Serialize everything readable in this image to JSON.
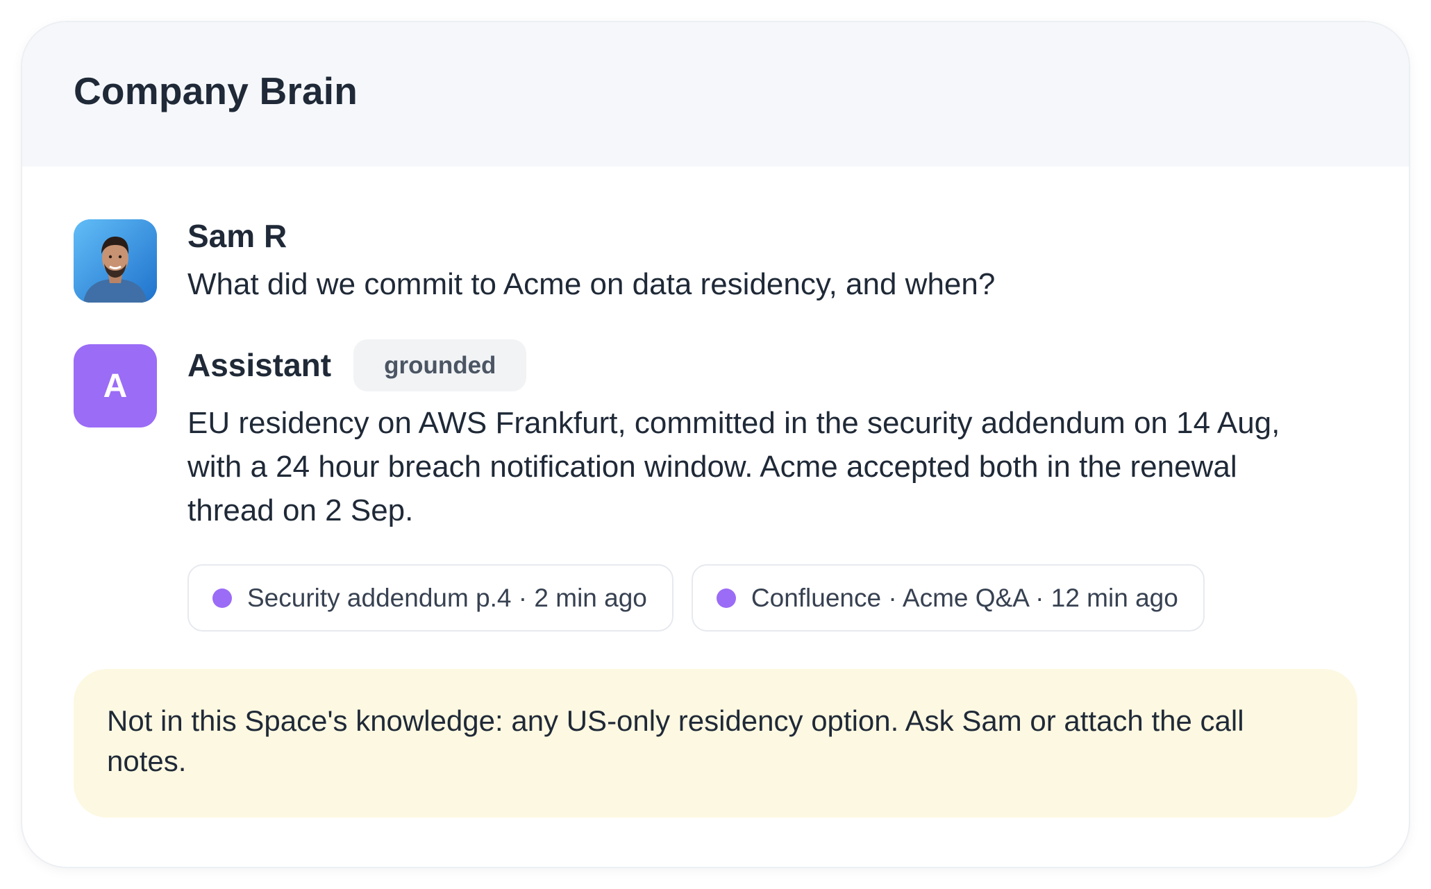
{
  "header": {
    "title": "Company Brain"
  },
  "messages": [
    {
      "sender": "Sam R",
      "avatar_type": "photo",
      "text": "What did we commit to Acme on data residency, and when?"
    },
    {
      "sender": "Assistant",
      "avatar_letter": "A",
      "avatar_color": "#9b6cf6",
      "badge": "grounded",
      "text": "EU residency on AWS Frankfurt, committed in the security addendum on 14 Aug, with a 24 hour breach notification window. Acme accepted both in the renewal thread on 2 Sep.",
      "citations": [
        {
          "label": "Security addendum p.4 · 2 min ago",
          "dot_color": "#9b6cf6"
        },
        {
          "label": "Confluence · Acme Q&A · 12 min ago",
          "dot_color": "#9b6cf6"
        }
      ]
    }
  ],
  "notice": {
    "text": "Not in this Space's knowledge: any US-only residency option. Ask Sam or attach the call notes.",
    "background": "#fdf8e1"
  }
}
